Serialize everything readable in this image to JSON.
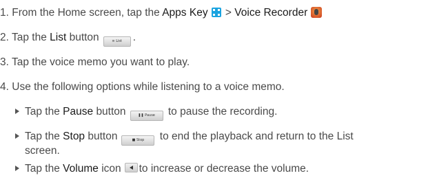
{
  "steps": [
    {
      "num": "1.",
      "pre": "From the Home screen, tap the",
      "apps_key": "Apps Key",
      "sep": ">",
      "voice_recorder": "Voice Recorder"
    },
    {
      "num": "2.",
      "pre": "Tap the",
      "bold": "List",
      "post": "button",
      "button_text": "≡ List"
    },
    {
      "num": "3.",
      "text": "Tap the voice memo you want to play."
    },
    {
      "num": "4.",
      "text": "Use the following options while listening to a voice memo."
    }
  ],
  "options": [
    {
      "pre": "Tap the",
      "bold": "Pause",
      "post": "button",
      "button_text": "❚❚ Pause",
      "tail": "to pause the recording."
    },
    {
      "pre": "Tap the",
      "bold": "Stop",
      "post": "button",
      "button_text": "■ Stop",
      "tail": "to end the playback and return to the List",
      "tail2": "screen."
    },
    {
      "pre": "Tap the",
      "bold": "Volume",
      "post": "icon",
      "tail": "to increase or decrease the volume."
    }
  ],
  "icons": {
    "apps_key": "apps-grid-icon",
    "voice_recorder": "voice-recorder-app-icon",
    "volume": "volume-icon"
  }
}
